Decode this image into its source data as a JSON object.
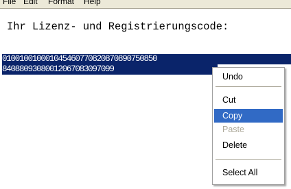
{
  "menubar": {
    "items": [
      "File",
      "Edit",
      "Format",
      "Help"
    ]
  },
  "editor": {
    "heading": "Ihr Lizenz- und Registrierungscode:",
    "code_lines": [
      "010010010001045460770820870890750850",
      "84088093080012067083097099"
    ]
  },
  "context_menu": {
    "undo": "Undo",
    "cut": "Cut",
    "copy": "Copy",
    "paste": "Paste",
    "delete": "Delete",
    "select_all": "Select All",
    "highlighted": "Copy",
    "disabled": [
      "Paste"
    ]
  },
  "colors": {
    "selection": "#0a246a",
    "menu_highlight": "#316ac5",
    "disabled_text": "#aca899"
  }
}
